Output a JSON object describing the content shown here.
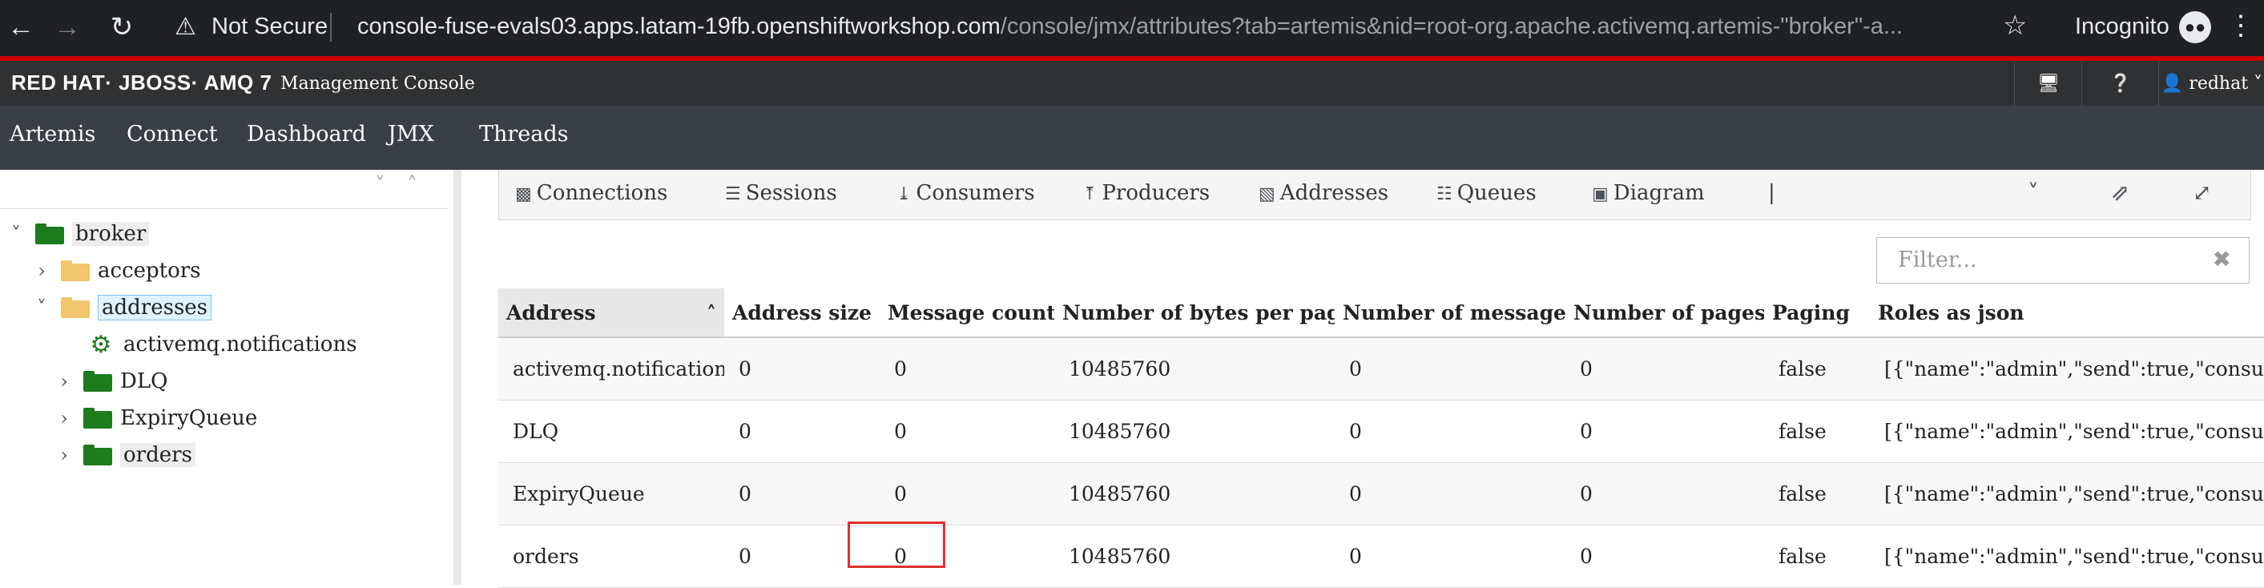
{
  "browser": {
    "back_icon": "arrow-left-icon",
    "forward_icon": "arrow-right-icon",
    "reload_icon": "reload-icon",
    "security_label": "Not Secure",
    "url_host": "console-fuse-evals03.apps.latam-19fb.openshiftworkshop.com",
    "url_path": "/console/jmx/attributes?tab=artemis&nid=root-org.apache.activemq.artemis-\"broker\"-a...",
    "incognito_label": "Incognito"
  },
  "header": {
    "logo_text": "RED HAT· JBOSS· AMQ 7",
    "logo_sub": "Management Console",
    "user": "redhat"
  },
  "nav": {
    "items": [
      "Artemis",
      "Connect",
      "Dashboard",
      "JMX",
      "Threads"
    ]
  },
  "tree": {
    "broker": "broker",
    "acceptors": "acceptors",
    "addresses": "addresses",
    "notifications": "activemq.notifications",
    "dlq": "DLQ",
    "expiry": "ExpiryQueue",
    "orders": "orders"
  },
  "tabs": {
    "connections": "Connections",
    "sessions": "Sessions",
    "consumers": "Consumers",
    "producers": "Producers",
    "addresses": "Addresses",
    "queues": "Queues",
    "diagram": "Diagram",
    "separator": "|"
  },
  "filter": {
    "placeholder": "Filter..."
  },
  "table": {
    "columns": [
      "Address",
      "Address size",
      "Message count",
      "Number of bytes per page",
      "Number of messages",
      "Number of pages",
      "Paging",
      "Roles as json"
    ],
    "rows": [
      [
        "activemq.notifications",
        "0",
        "0",
        "10485760",
        "0",
        "0",
        "false",
        "[{\"name\":\"admin\",\"send\":true,\"consume\":"
      ],
      [
        "DLQ",
        "0",
        "0",
        "10485760",
        "0",
        "0",
        "false",
        "[{\"name\":\"admin\",\"send\":true,\"consume\":"
      ],
      [
        "ExpiryQueue",
        "0",
        "0",
        "10485760",
        "0",
        "0",
        "false",
        "[{\"name\":\"admin\",\"send\":true,\"consume\":"
      ],
      [
        "orders",
        "0",
        "0",
        "10485760",
        "0",
        "0",
        "false",
        "[{\"name\":\"admin\",\"send\":true,\"consume\":"
      ]
    ]
  },
  "colors": {
    "accent_red": "#cc0000",
    "folder_green": "#1e7b1e",
    "folder_yellow": "#f0c66e",
    "highlight_box": "#e0322d"
  }
}
